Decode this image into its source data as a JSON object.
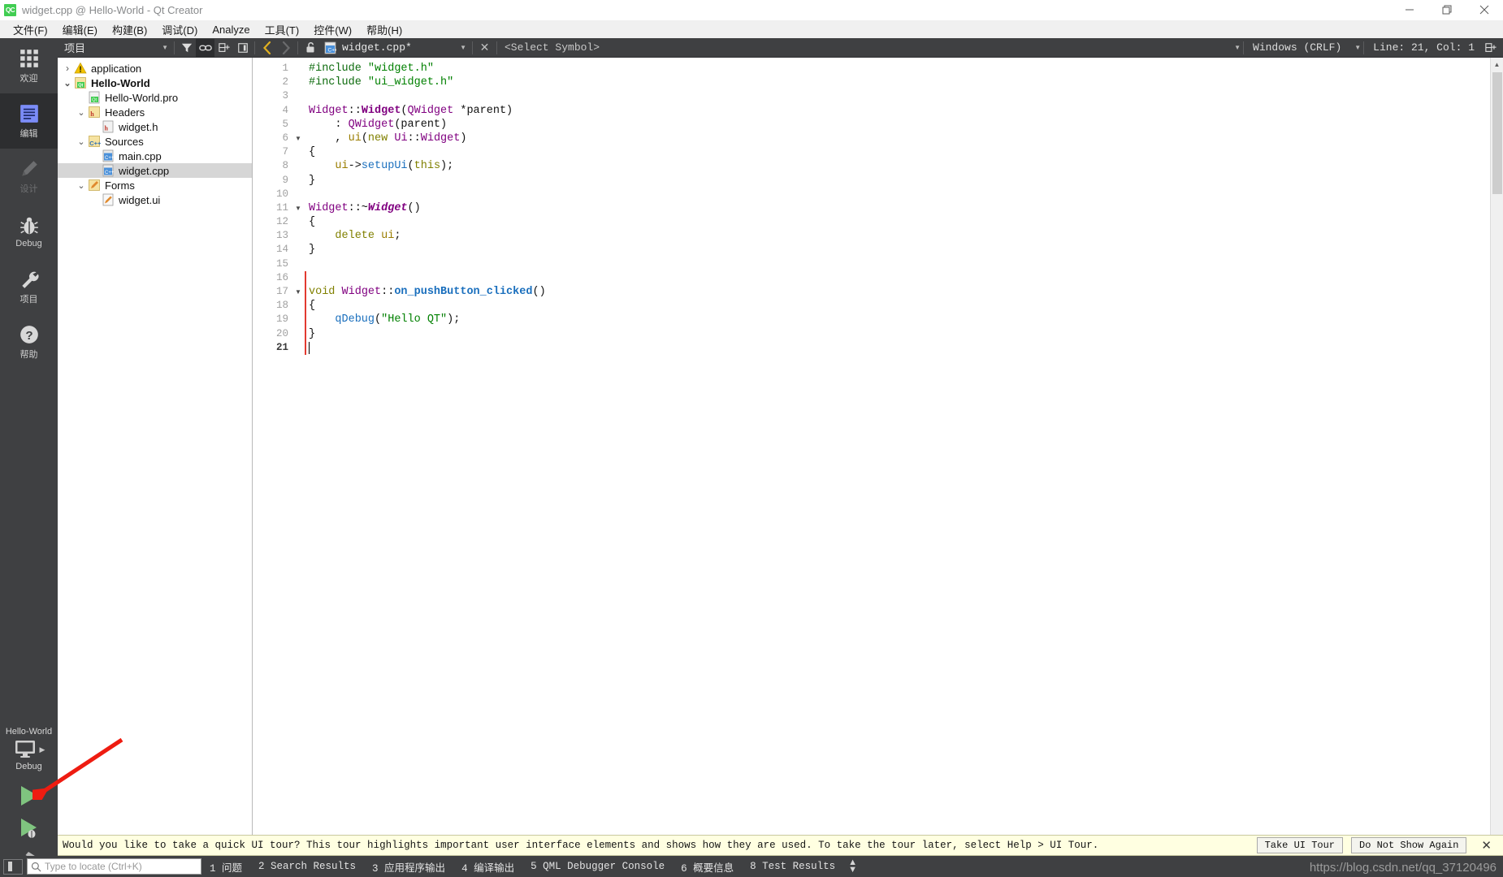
{
  "window": {
    "title": "widget.cpp @ Hello-World - Qt Creator",
    "logo_text": "QC",
    "controls": [
      {
        "name": "minimize",
        "glyph": "—"
      },
      {
        "name": "restore",
        "glyph": "❐"
      },
      {
        "name": "close",
        "glyph": "✕"
      }
    ]
  },
  "menubar": {
    "items": [
      "文件(F)",
      "编辑(E)",
      "构建(B)",
      "调试(D)",
      "Analyze",
      "工具(T)",
      "控件(W)",
      "帮助(H)"
    ]
  },
  "modebar": {
    "items": [
      {
        "label": "欢迎",
        "icon": "grid-icon",
        "state": "normal"
      },
      {
        "label": "编辑",
        "icon": "edit-lines-icon",
        "state": "active"
      },
      {
        "label": "设计",
        "icon": "pencil-icon",
        "state": "disabled"
      },
      {
        "label": "Debug",
        "icon": "bug-icon",
        "state": "normal"
      },
      {
        "label": "项目",
        "icon": "wrench-icon",
        "state": "normal"
      },
      {
        "label": "帮助",
        "icon": "question-icon",
        "state": "normal"
      }
    ],
    "kit": {
      "project_name": "Hello-World",
      "build_config": "Debug",
      "monitor_icon": "monitor-icon",
      "run_icon": "run-play-icon",
      "debug_icon": "debug-play-icon",
      "build_icon": "hammer-icon"
    }
  },
  "toolbar": {
    "project_selector": "项目",
    "icons": [
      {
        "name": "filter-icon",
        "selected": false
      },
      {
        "name": "link-sync-icon",
        "selected": true
      },
      {
        "name": "split-add-icon",
        "selected": false
      },
      {
        "name": "collapse-sidebar-icon",
        "selected": false
      }
    ],
    "nav_back": "back-arrow-icon",
    "nav_forward": "forward-arrow-icon",
    "lock": "unlock-icon",
    "file_icon": "cpp-file-icon",
    "file_name": "widget.cpp*",
    "close_file": "✕",
    "symbol_selector": "<Select Symbol>",
    "line_ending": "Windows (CRLF)",
    "cursor_position": "Line: 21, Col: 1",
    "split_editor_icon": "split-editor-icon"
  },
  "project_tree": {
    "rows": [
      {
        "indent": 0,
        "arrow": "collapsed",
        "icon": "warning-icon",
        "label": "application",
        "bold": false,
        "selected": false
      },
      {
        "indent": 0,
        "arrow": "expanded",
        "icon": "qt-project-icon",
        "label": "Hello-World",
        "bold": true,
        "selected": false
      },
      {
        "indent": 1,
        "arrow": "none",
        "icon": "pro-file-icon",
        "label": "Hello-World.pro",
        "bold": false,
        "selected": false
      },
      {
        "indent": 1,
        "arrow": "expanded",
        "icon": "headers-folder-icon",
        "label": "Headers",
        "bold": false,
        "selected": false
      },
      {
        "indent": 2,
        "arrow": "none",
        "icon": "h-file-icon",
        "label": "widget.h",
        "bold": false,
        "selected": false
      },
      {
        "indent": 1,
        "arrow": "expanded",
        "icon": "sources-folder-icon",
        "label": "Sources",
        "bold": false,
        "selected": false
      },
      {
        "indent": 2,
        "arrow": "none",
        "icon": "cpp-file-icon",
        "label": "main.cpp",
        "bold": false,
        "selected": false
      },
      {
        "indent": 2,
        "arrow": "none",
        "icon": "cpp-file-icon",
        "label": "widget.cpp",
        "bold": false,
        "selected": true
      },
      {
        "indent": 1,
        "arrow": "expanded",
        "icon": "forms-folder-icon",
        "label": "Forms",
        "bold": false,
        "selected": false
      },
      {
        "indent": 2,
        "arrow": "none",
        "icon": "ui-file-icon",
        "label": "widget.ui",
        "bold": false,
        "selected": false
      }
    ]
  },
  "editor": {
    "total_lines": 21,
    "cursor_line": 21,
    "changed_lines": [
      16,
      17,
      18,
      19,
      20,
      21
    ],
    "fold_markers": [
      6,
      11,
      17
    ],
    "lines": [
      {
        "n": 1,
        "tokens": [
          {
            "t": "#include ",
            "c": "t-pre"
          },
          {
            "t": "\"widget.h\"",
            "c": "t-str"
          }
        ]
      },
      {
        "n": 2,
        "tokens": [
          {
            "t": "#include ",
            "c": "t-pre"
          },
          {
            "t": "\"ui_widget.h\"",
            "c": "t-str"
          }
        ]
      },
      {
        "n": 3,
        "tokens": []
      },
      {
        "n": 4,
        "tokens": [
          {
            "t": "Widget",
            "c": "t-typen"
          },
          {
            "t": "::",
            "c": "t-plain"
          },
          {
            "t": "Widget",
            "c": "t-type"
          },
          {
            "t": "(",
            "c": "t-plain"
          },
          {
            "t": "QWidget",
            "c": "t-typen"
          },
          {
            "t": " *parent)",
            "c": "t-plain"
          }
        ]
      },
      {
        "n": 5,
        "tokens": [
          {
            "t": "    : ",
            "c": "t-plain"
          },
          {
            "t": "QWidget",
            "c": "t-typen"
          },
          {
            "t": "(parent)",
            "c": "t-plain"
          }
        ]
      },
      {
        "n": 6,
        "tokens": [
          {
            "t": "    , ",
            "c": "t-plain"
          },
          {
            "t": "ui",
            "c": "t-var"
          },
          {
            "t": "(",
            "c": "t-plain"
          },
          {
            "t": "new",
            "c": "t-kw"
          },
          {
            "t": " ",
            "c": "t-plain"
          },
          {
            "t": "Ui",
            "c": "t-typen"
          },
          {
            "t": "::",
            "c": "t-plain"
          },
          {
            "t": "Widget",
            "c": "t-typen"
          },
          {
            "t": ")",
            "c": "t-plain"
          }
        ]
      },
      {
        "n": 7,
        "tokens": [
          {
            "t": "{",
            "c": "t-plain"
          }
        ]
      },
      {
        "n": 8,
        "tokens": [
          {
            "t": "    ",
            "c": "t-plain"
          },
          {
            "t": "ui",
            "c": "t-var"
          },
          {
            "t": "->",
            "c": "t-plain"
          },
          {
            "t": "setupUi",
            "c": "t-fn2"
          },
          {
            "t": "(",
            "c": "t-plain"
          },
          {
            "t": "this",
            "c": "t-kw"
          },
          {
            "t": ");",
            "c": "t-plain"
          }
        ]
      },
      {
        "n": 9,
        "tokens": [
          {
            "t": "}",
            "c": "t-plain"
          }
        ]
      },
      {
        "n": 10,
        "tokens": []
      },
      {
        "n": 11,
        "tokens": [
          {
            "t": "Widget",
            "c": "t-typen"
          },
          {
            "t": "::~",
            "c": "t-plain"
          },
          {
            "t": "Widget",
            "c": "t-italic"
          },
          {
            "t": "()",
            "c": "t-plain"
          }
        ]
      },
      {
        "n": 12,
        "tokens": [
          {
            "t": "{",
            "c": "t-plain"
          }
        ]
      },
      {
        "n": 13,
        "tokens": [
          {
            "t": "    ",
            "c": "t-plain"
          },
          {
            "t": "delete",
            "c": "t-kw"
          },
          {
            "t": " ",
            "c": "t-plain"
          },
          {
            "t": "ui",
            "c": "t-var"
          },
          {
            "t": ";",
            "c": "t-plain"
          }
        ]
      },
      {
        "n": 14,
        "tokens": [
          {
            "t": "}",
            "c": "t-plain"
          }
        ]
      },
      {
        "n": 15,
        "tokens": []
      },
      {
        "n": 16,
        "tokens": []
      },
      {
        "n": 17,
        "tokens": [
          {
            "t": "void",
            "c": "t-kw"
          },
          {
            "t": " ",
            "c": "t-plain"
          },
          {
            "t": "Widget",
            "c": "t-typen"
          },
          {
            "t": "::",
            "c": "t-plain"
          },
          {
            "t": "on_pushButton_clicked",
            "c": "t-fn"
          },
          {
            "t": "()",
            "c": "t-plain"
          }
        ]
      },
      {
        "n": 18,
        "tokens": [
          {
            "t": "{",
            "c": "t-plain"
          }
        ]
      },
      {
        "n": 19,
        "tokens": [
          {
            "t": "    ",
            "c": "t-plain"
          },
          {
            "t": "qDebug",
            "c": "t-fn2"
          },
          {
            "t": "(",
            "c": "t-plain"
          },
          {
            "t": "\"Hello QT\"",
            "c": "t-str"
          },
          {
            "t": ");",
            "c": "t-plain"
          }
        ]
      },
      {
        "n": 20,
        "tokens": [
          {
            "t": "}",
            "c": "t-plain"
          }
        ]
      },
      {
        "n": 21,
        "tokens": []
      }
    ]
  },
  "banner": {
    "message": "Would you like to take a quick UI tour? This tour highlights important user interface elements and shows how they are used. To take the tour later, select Help > UI Tour.",
    "take_tour_label": "Take UI Tour",
    "dismiss_label": "Do Not Show Again",
    "close_glyph": "✕"
  },
  "statusbar": {
    "locator_placeholder": "Type to locate (Ctrl+K)",
    "panes": [
      "1 问题",
      "2 Search Results",
      "3 应用程序输出",
      "4 编译输出",
      "5 QML Debugger Console",
      "6 概要信息",
      "8 Test Results"
    ]
  },
  "watermark": "https://blog.csdn.net/qq_37120496",
  "colors": {
    "chrome_dark": "#3f4042",
    "mode_active": "#2d2e30",
    "accent_blue": "#6a7df5",
    "run_green": "#60c060",
    "banner_bg": "#ffffe1",
    "change_marker": "#e23a30",
    "annotation_red": "#ee1c11"
  }
}
